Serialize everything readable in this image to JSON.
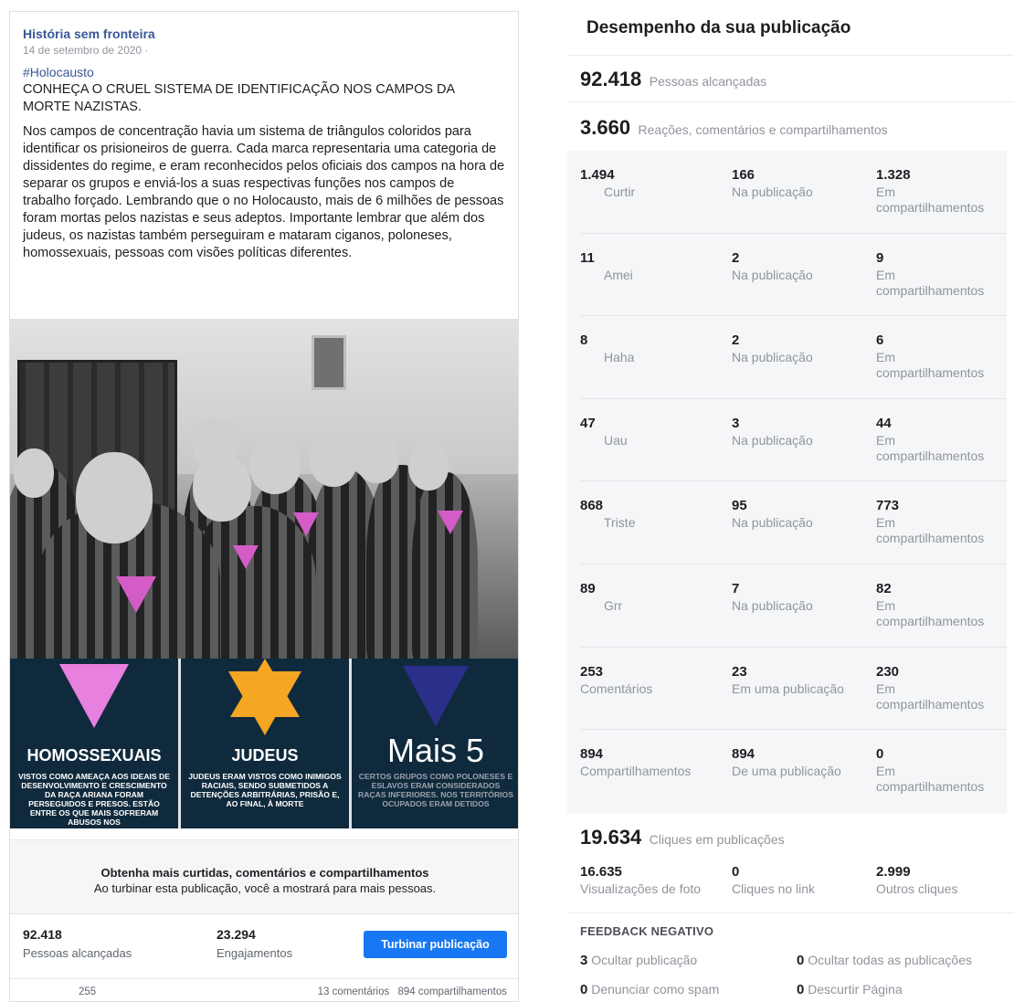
{
  "post": {
    "page_name": "História sem fronteira",
    "date": "14 de setembro de 2020 ·",
    "hashtag": "#Holocausto",
    "headline": "CONHEÇA O CRUEL SISTEMA DE IDENTIFICAÇÃO NOS CAMPOS DA MORTE NAZISTAS.",
    "body": "Nos campos de concentração havia um sistema de triângulos coloridos para identificar os prisioneiros de guerra. Cada marca representaria uma categoria de dissidentes do regime, e eram reconhecidos pelos oficiais dos campos na hora de separar os grupos e enviá-los a suas respectivas funções nos campos de trabalho forçado. Lembrando que o no Holocausto, mais de 6 milhões de pessoas foram mortas pelos nazistas e seus adeptos. Importante lembrar que além dos judeus, os nazistas também perseguiram e mataram ciganos, poloneses, homossexuais, pessoas com visões políticas diferentes.",
    "cards": [
      {
        "title": "HOMOSSEXUAIS",
        "text": "VISTOS COMO AMEAÇA AOS IDEAIS DE DESENVOLVIMENTO E CRESCIMENTO DA RAÇA ARIANA FORAM PERSEGUIDOS E PRESOS. ESTÃO ENTRE OS QUE MAIS SOFRERAM ABUSOS NOS",
        "symbol": "pink-triangle",
        "color": "#e880e0"
      },
      {
        "title": "JUDEUS",
        "text": "JUDEUS ERAM VISTOS COMO INIMIGOS RACIAIS, SENDO SUBMETIDOS A DETENÇÕES ARBITRÁRIAS, PRISÃO E, AO FINAL, À MORTE",
        "symbol": "yellow-star",
        "color": "#f5a623"
      },
      {
        "title": "",
        "text": "CERTOS GRUPOS COMO POLONESES E ESLAVOS ERAM CONSIDERADOS RAÇAS INFERIORES. NOS TERRITÓRIOS OCUPADOS ERAM DETIDOS",
        "symbol": "navy-triangle",
        "color": "#2a2f8a",
        "more": "Mais 5"
      }
    ],
    "boost_title": "Obtenha mais curtidas, comentários e compartilhamentos",
    "boost_subtitle": "Ao turbinar esta publicação, você a mostrará para mais pessoas.",
    "reach_value": "92.418",
    "reach_label": "Pessoas alcançadas",
    "engagement_value": "23.294",
    "engagement_label": "Engajamentos",
    "boost_button": "Turbinar publicação",
    "likes_count": "255",
    "comments": "13 comentários",
    "shares": "894 compartilhamentos",
    "accent": "#1877f2"
  },
  "insights": {
    "title": "Desempenho da sua publicação",
    "reach": {
      "value": "92.418",
      "label": "Pessoas alcançadas"
    },
    "reactions_total": {
      "value": "3.660",
      "label": "Reações, comentários e compartilhamentos"
    },
    "rows": [
      {
        "total": "1.494",
        "label": "Curtir",
        "on_post": "166",
        "on_post_label": "Na publicação",
        "on_shares": "1.328",
        "on_shares_label": "Em compartilhamentos"
      },
      {
        "total": "11",
        "label": "Amei",
        "on_post": "2",
        "on_post_label": "Na publicação",
        "on_shares": "9",
        "on_shares_label": "Em compartilhamentos"
      },
      {
        "total": "8",
        "label": "Haha",
        "on_post": "2",
        "on_post_label": "Na publicação",
        "on_shares": "6",
        "on_shares_label": "Em compartilhamentos"
      },
      {
        "total": "47",
        "label": "Uau",
        "on_post": "3",
        "on_post_label": "Na publicação",
        "on_shares": "44",
        "on_shares_label": "Em compartilhamentos"
      },
      {
        "total": "868",
        "label": "Triste",
        "on_post": "95",
        "on_post_label": "Na publicação",
        "on_shares": "773",
        "on_shares_label": "Em compartilhamentos"
      },
      {
        "total": "89",
        "label": "Grr",
        "on_post": "7",
        "on_post_label": "Na publicação",
        "on_shares": "82",
        "on_shares_label": "Em compartilhamentos"
      },
      {
        "total": "253",
        "label": "Comentários",
        "on_post": "23",
        "on_post_label": "Em uma publicação",
        "on_shares": "230",
        "on_shares_label": "Em compartilhamentos"
      },
      {
        "total": "894",
        "label": "Compartilhamentos",
        "on_post": "894",
        "on_post_label": "De uma publicação",
        "on_shares": "0",
        "on_shares_label": "Em compartilhamentos"
      }
    ],
    "clicks_total": {
      "value": "19.634",
      "label": "Cliques em publicações"
    },
    "clicks": [
      {
        "value": "16.635",
        "label": "Visualizações de foto"
      },
      {
        "value": "0",
        "label": "Cliques no link"
      },
      {
        "value": "2.999",
        "label": "Outros cliques"
      }
    ],
    "negative_title": "FEEDBACK NEGATIVO",
    "negative": [
      {
        "value": "3",
        "label": "Ocultar publicação"
      },
      {
        "value": "0",
        "label": "Ocultar todas as publicações"
      },
      {
        "value": "0",
        "label": "Denunciar como spam"
      },
      {
        "value": "0",
        "label": "Descurtir Página"
      }
    ]
  }
}
